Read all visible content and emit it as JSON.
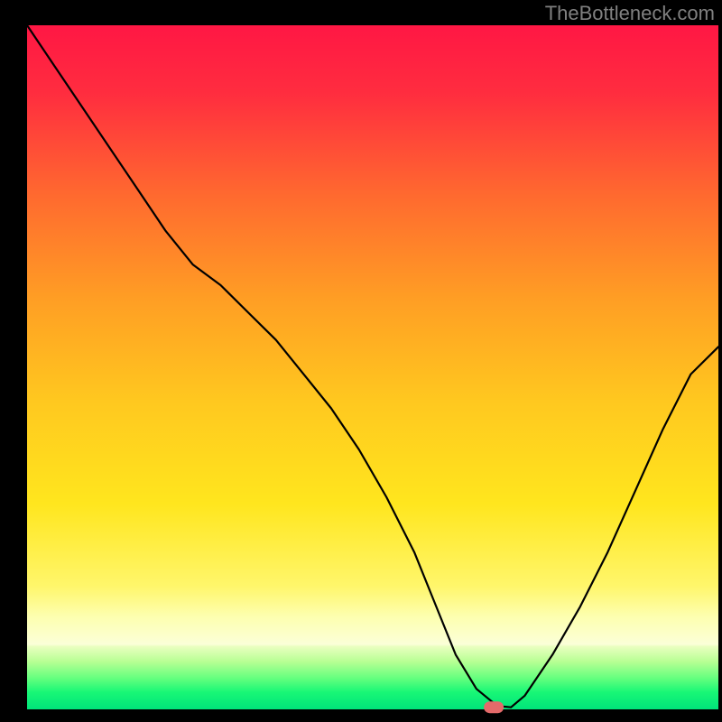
{
  "watermark": "TheBottleneck.com",
  "chart_data": {
    "type": "line",
    "title": "",
    "xlabel": "",
    "ylabel": "",
    "xlim": [
      0,
      100
    ],
    "ylim": [
      0,
      100
    ],
    "x": [
      0,
      4,
      8,
      12,
      16,
      20,
      24,
      28,
      32,
      36,
      40,
      44,
      48,
      52,
      56,
      58,
      60,
      62,
      65,
      68,
      70,
      72,
      76,
      80,
      84,
      88,
      92,
      96,
      100
    ],
    "values": [
      100,
      94,
      88,
      82,
      76,
      70,
      65,
      62,
      58,
      54,
      49,
      44,
      38,
      31,
      23,
      18,
      13,
      8,
      3,
      0.5,
      0.3,
      2,
      8,
      15,
      23,
      32,
      41,
      49,
      53
    ],
    "note": "V-shaped bottleneck curve; minimum near x=68-70, approximate percentage values read from vertical position on red-to-green gradient",
    "marker": {
      "x": 67.5,
      "y": 0.3
    },
    "gradient_bands": {
      "description": "vertical gradient from red at top through orange/yellow to faint yellow-white band near bottom, then narrow green band at very bottom above black axis",
      "colors_top_to_bottom": [
        "#ff173f",
        "#ff5a36",
        "#ffa628",
        "#ffd21f",
        "#ffee1e",
        "#fff97a",
        "#f4ffbf",
        "#c9ff9f",
        "#3dff82",
        "#00e676"
      ]
    },
    "frame": {
      "left_border_px": 30,
      "right_border_px": 4,
      "top_border_px": 28,
      "bottom_border_px": 14,
      "border_color": "#000000"
    }
  }
}
